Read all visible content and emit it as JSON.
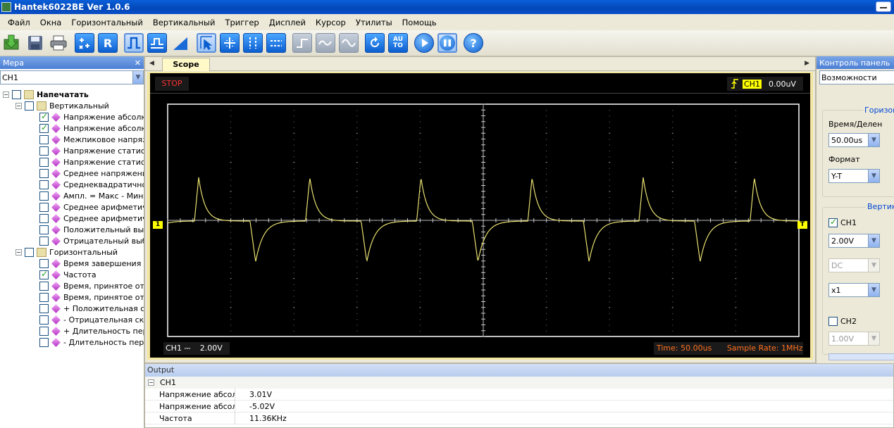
{
  "window": {
    "title": "Hantek6022BE Ver 1.0.6"
  },
  "menu": [
    "Файл",
    "Окна",
    "Горизонтальный",
    "Вертикальный",
    "Триггер",
    "Дисплей",
    "Курсор",
    "Утилиты",
    "Помощь"
  ],
  "toolbar": {
    "buttons": [
      "open-icon",
      "save-icon",
      "print-icon",
      "cross-cursor-icon",
      "reference-icon",
      "square-wave-icon",
      "pulse-icon",
      "ramp-icon",
      "select-cursor-icon",
      "grid-icon",
      "vertical-cursor-icon",
      "horizontal-cursor-icon",
      "step-icon",
      "wave-icon",
      "sine-icon",
      "refresh-icon",
      "auto-icon",
      "play-icon",
      "pause-icon",
      "help-icon"
    ],
    "auto_label": "AU\nTO",
    "ref_label": "R",
    "help_label": "?"
  },
  "left_panel": {
    "title": "Мера",
    "close": "✕",
    "channel_select": "CH1",
    "root": "Напечатать",
    "vertical_group": "Вертикальный",
    "vertical_items": [
      {
        "label": "Напряжение абсолютн",
        "checked": true
      },
      {
        "label": "Напряжение абсолютн",
        "checked": true
      },
      {
        "label": "Межпиковое напряжен",
        "checked": false
      },
      {
        "label": "Напряжение статистич",
        "checked": false
      },
      {
        "label": "Напряжение статистич",
        "checked": false
      },
      {
        "label": "Среднее напряжение п",
        "checked": false
      },
      {
        "label": "Среднеквадратичное",
        "checked": false
      },
      {
        "label": "Ампл. = Макс - Мин, из",
        "checked": false
      },
      {
        "label": "Среднее арифметичес",
        "checked": false
      },
      {
        "label": "Среднее арифметичес",
        "checked": false
      },
      {
        "label": "Положительный выбро",
        "checked": false
      },
      {
        "label": "Отрицательный выбро",
        "checked": false
      }
    ],
    "horizontal_group": "Горизонтальный",
    "horizontal_items": [
      {
        "label": "Время завершения пер",
        "checked": false
      },
      {
        "label": "Частота",
        "checked": true
      },
      {
        "label": "Время, принятое от ни",
        "checked": false
      },
      {
        "label": "Время, принятое от ве",
        "checked": false
      },
      {
        "label": "+ Положительная скв",
        "checked": false
      },
      {
        "label": "- Отрицательная скваз",
        "checked": false
      },
      {
        "label": "+ Длительность перво",
        "checked": false
      },
      {
        "label": "- Длительность перво",
        "checked": false
      }
    ]
  },
  "scope": {
    "tab": "Scope",
    "status": "STOP",
    "trigger_channel": "CH1",
    "trigger_level": "0.00uV",
    "ch_marker": "1",
    "trig_marker": "T",
    "bottom_channel": "CH1 ⎓",
    "bottom_volts": "2.00V",
    "time_label": "Time: 50.00us",
    "sample_rate": "Sample Rate: 1MHz",
    "trace_color": "#e8e070"
  },
  "right_panel": {
    "title": "Контроль панель",
    "mode": "Возможности",
    "horizontal_group": "Горизонт",
    "time_div_label": "Время/Делен",
    "time_div": "50.00us",
    "format_label": "Формат",
    "format": "Y-T",
    "vertical_group": "Вертика",
    "ch1_label": "CH1",
    "ch1_checked": true,
    "ch1_volts": "2.00V",
    "coupling": "DC",
    "probe": "x1",
    "ch2_label": "CH2",
    "ch2_checked": false,
    "ch2_volts": "1.00V"
  },
  "output": {
    "title": "Output",
    "group": "CH1",
    "rows": [
      {
        "key": "Напряжение абсол...",
        "value": "3.01V"
      },
      {
        "key": "Напряжение абсол...",
        "value": "-5.02V"
      },
      {
        "key": "Частота",
        "value": "11.36KHz"
      }
    ]
  }
}
